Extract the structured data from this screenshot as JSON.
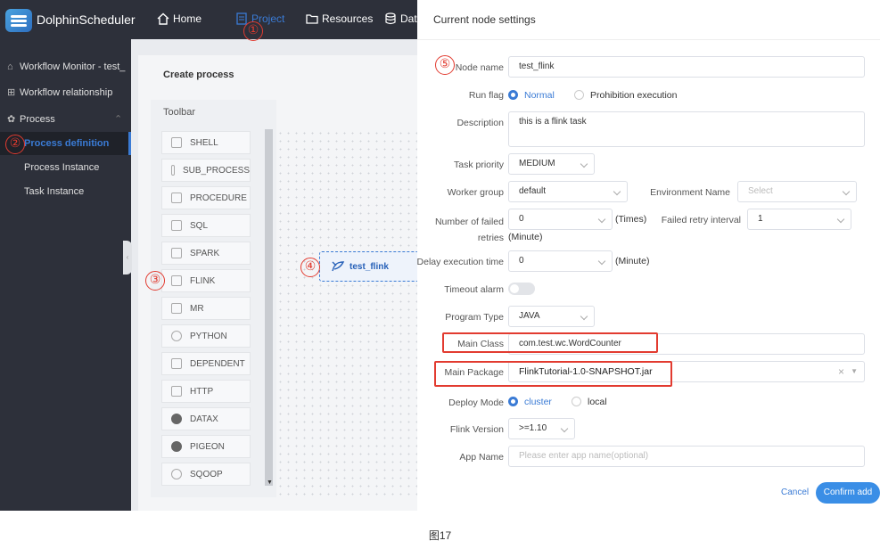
{
  "header": {
    "brand": "DolphinScheduler",
    "nav": {
      "home": "Home",
      "project": "Project",
      "resources": "Resources",
      "data": "Dat"
    }
  },
  "sidebar": {
    "items": [
      {
        "label": "Workflow Monitor - test_",
        "icon": "home-icon"
      },
      {
        "label": "Workflow relationship",
        "icon": "relationship-icon"
      },
      {
        "label": "Process",
        "icon": "gear-icon"
      },
      {
        "label": "Process definition"
      },
      {
        "label": "Process Instance"
      },
      {
        "label": "Task Instance"
      }
    ]
  },
  "canvas": {
    "title": "Create process",
    "toolbar_label": "Toolbar",
    "tools": [
      "SHELL",
      "SUB_PROCESS",
      "PROCEDURE",
      "SQL",
      "SPARK",
      "FLINK",
      "MR",
      "PYTHON",
      "DEPENDENT",
      "HTTP",
      "DATAX",
      "PIGEON",
      "SQOOP"
    ],
    "node_label": "test_flink"
  },
  "markers": [
    "①",
    "②",
    "③",
    "④",
    "⑤"
  ],
  "drawer": {
    "title": "Current node settings",
    "node_name": {
      "label": "Node name",
      "value": "test_flink"
    },
    "run_flag": {
      "label": "Run flag",
      "options": [
        "Normal",
        "Prohibition execution"
      ],
      "selected": "Normal"
    },
    "description": {
      "label": "Description",
      "value": "this is a flink task"
    },
    "task_priority": {
      "label": "Task priority",
      "value": "MEDIUM"
    },
    "worker_group": {
      "label": "Worker group",
      "value": "default"
    },
    "environment_name": {
      "label": "Environment Name",
      "placeholder": "Select"
    },
    "failed_retries": {
      "label": "Number of failed retries",
      "value": "0",
      "unit": "(Times)"
    },
    "retry_interval": {
      "label": "Failed retry interval",
      "value": "1",
      "unit": "(Minute)"
    },
    "delay_time": {
      "label": "Delay execution time",
      "value": "0",
      "unit": "(Minute)"
    },
    "timeout_alarm": {
      "label": "Timeout alarm"
    },
    "program_type": {
      "label": "Program Type",
      "value": "JAVA"
    },
    "main_class": {
      "label": "Main Class",
      "value": "com.test.wc.WordCounter"
    },
    "main_package": {
      "label": "Main Package",
      "value": "FlinkTutorial-1.0-SNAPSHOT.jar",
      "clear": "×"
    },
    "deploy_mode": {
      "label": "Deploy Mode",
      "options": [
        "cluster",
        "local"
      ],
      "selected": "cluster"
    },
    "flink_version": {
      "label": "Flink Version",
      "value": ">=1.10"
    },
    "app_name": {
      "label": "App Name",
      "placeholder": "Please enter app name(optional)"
    },
    "cancel": "Cancel",
    "confirm": "Confirm add"
  },
  "caption": "图17",
  "colors": {
    "accent": "#3a7bd5",
    "marker": "#e23b30",
    "sidebar": "#2d303a"
  }
}
